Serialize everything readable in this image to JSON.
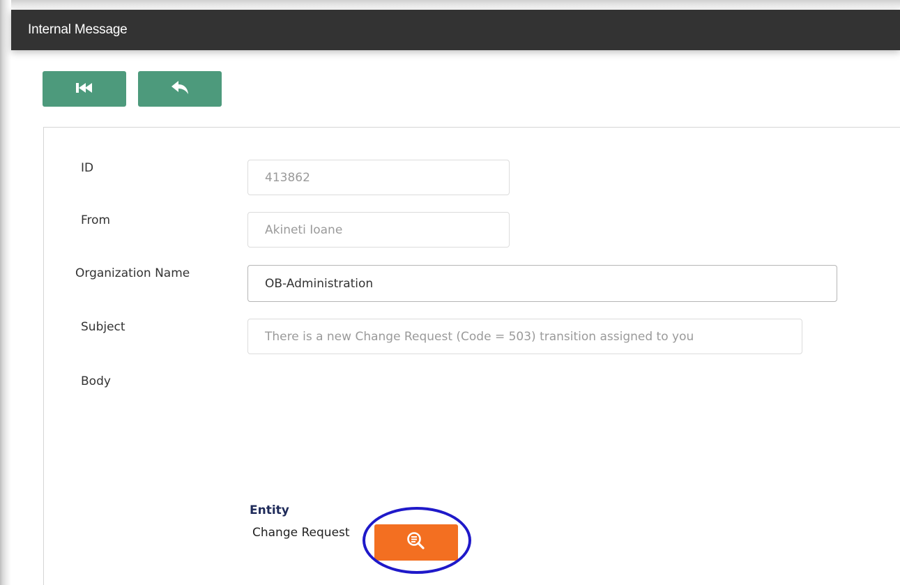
{
  "window": {
    "title": "Internal Message"
  },
  "toolbar": {
    "first_icon": "skip-to-first-icon",
    "back_icon": "reply-back-icon",
    "button_color": "#4d9a7c"
  },
  "form": {
    "id": {
      "label": "ID",
      "value": "413862"
    },
    "from": {
      "label": "From",
      "value": "Akineti Ioane"
    },
    "organization": {
      "label": "Organization Name",
      "value": "OB-Administration"
    },
    "subject": {
      "label": "Subject",
      "value": "There is a new Change Request (Code = 503) transition assigned to you"
    },
    "body": {
      "label": "Body"
    }
  },
  "entity": {
    "heading": "Entity",
    "value": "Change Request",
    "button_icon": "search-document-icon",
    "button_color": "#f36f21",
    "highlight_color": "#1f19c9"
  },
  "colors": {
    "titlebar": "#333333",
    "entity_heading": "#1f2b5a"
  }
}
